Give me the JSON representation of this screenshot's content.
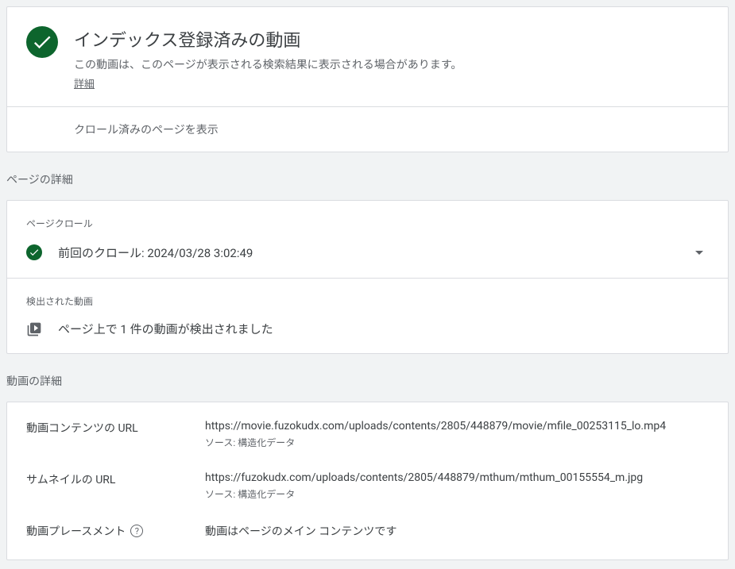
{
  "header": {
    "title": "インデックス登録済みの動画",
    "description": "この動画は、このページが表示される検索結果に表示される場合があります。",
    "details_link": "詳細"
  },
  "action": {
    "show_crawled": "クロール済みのページを表示"
  },
  "page_details": {
    "section_title": "ページの詳細",
    "crawl_label": "ページクロール",
    "last_crawl_prefix": "前回のクロール: ",
    "last_crawl_value": "2024/03/28 3:02:49",
    "detected_label": "検出された動画",
    "detected_text": "ページ上で 1 件の動画が検出されました"
  },
  "video_details": {
    "section_title": "動画の詳細",
    "rows": [
      {
        "label": "動画コンテンツの URL",
        "value": "https://movie.fuzokudx.com/uploads/contents/2805/448879/movie/mfile_00253115_lo.mp4",
        "source": "ソース: 構造化データ",
        "help": false
      },
      {
        "label": "サムネイルの URL",
        "value": "https://fuzokudx.com/uploads/contents/2805/448879/mthum/mthum_00155554_m.jpg",
        "source": "ソース: 構造化データ",
        "help": false
      },
      {
        "label": "動画プレースメント",
        "value": "動画はページのメイン コンテンツです",
        "source": "",
        "help": true
      }
    ]
  }
}
